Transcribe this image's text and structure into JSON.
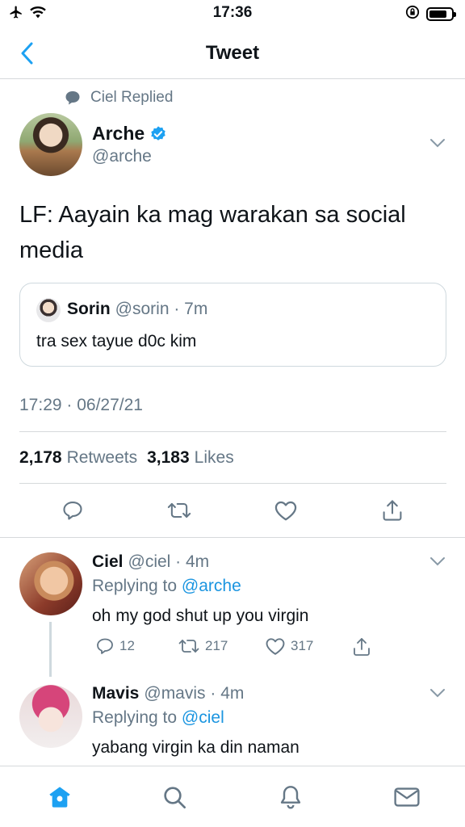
{
  "status_bar": {
    "time": "17:36"
  },
  "header": {
    "title": "Tweet"
  },
  "main_tweet": {
    "replied_label": "Ciel Replied",
    "author_name": "Arche",
    "author_handle": "@arche",
    "text": "LF: Aayain ka mag warakan sa social media",
    "quote": {
      "name": "Sorin",
      "meta": "@sorin · 7m",
      "text": "tra sex tayue d0c kim"
    },
    "timestamp": "17:29 · 06/27/21",
    "retweets_count": "2,178",
    "retweets_label": "Retweets",
    "likes_count": "3,183",
    "likes_label": "Likes"
  },
  "replies": [
    {
      "name": "Ciel",
      "meta": "@ciel · 4m",
      "replying_prefix": "Replying to",
      "replying_to": "@arche",
      "text": "oh my god shut up you virgin",
      "replies_count": "12",
      "retweets_count": "217",
      "likes_count": "317"
    },
    {
      "name": "Mavis",
      "meta": "@mavis · 4m",
      "replying_prefix": "Replying to",
      "replying_to": "@ciel",
      "text": "yabang virgin ka din naman"
    }
  ],
  "colors": {
    "accent": "#1da1f2",
    "link": "#1b95e0",
    "muted_text": "#657786",
    "divider": "#d6d9db"
  },
  "battery_level": 0.8
}
